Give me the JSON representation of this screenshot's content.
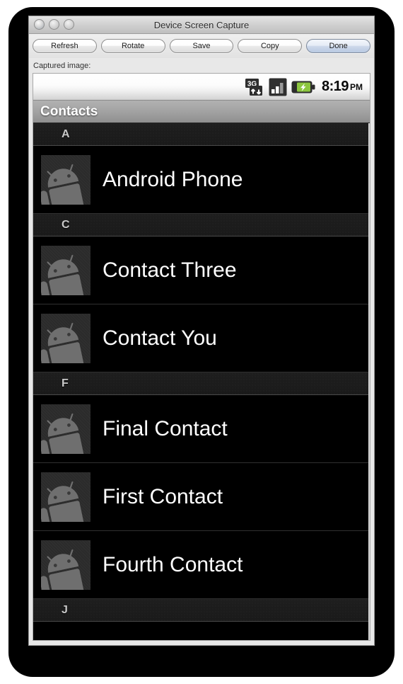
{
  "window": {
    "title": "Device Screen Capture",
    "traffic_lights": [
      "close",
      "minimize",
      "zoom"
    ]
  },
  "toolbar": {
    "buttons": [
      {
        "label": "Refresh",
        "name": "refresh-button",
        "default": false
      },
      {
        "label": "Rotate",
        "name": "rotate-button",
        "default": false
      },
      {
        "label": "Save",
        "name": "save-button",
        "default": false
      },
      {
        "label": "Copy",
        "name": "copy-button",
        "default": false
      },
      {
        "label": "Done",
        "name": "done-button",
        "default": true
      }
    ]
  },
  "captured": {
    "label": "Captured image:"
  },
  "device": {
    "statusbar": {
      "icons": [
        "3g-data-icon",
        "signal-bars-icon",
        "battery-charging-icon"
      ],
      "time": "8:19",
      "ampm": "PM"
    },
    "app": {
      "title": "Contacts"
    },
    "list": [
      {
        "type": "section",
        "letter": "A"
      },
      {
        "type": "contact",
        "name": "Android Phone",
        "avatar": "android-robot-avatar"
      },
      {
        "type": "section",
        "letter": "C"
      },
      {
        "type": "contact",
        "name": "Contact Three",
        "avatar": "android-robot-avatar"
      },
      {
        "type": "contact",
        "name": "Contact You",
        "avatar": "android-robot-avatar"
      },
      {
        "type": "section",
        "letter": "F"
      },
      {
        "type": "contact",
        "name": "Final Contact",
        "avatar": "android-robot-avatar"
      },
      {
        "type": "contact",
        "name": "First Contact",
        "avatar": "android-robot-avatar"
      },
      {
        "type": "contact",
        "name": "Fourth Contact",
        "avatar": "android-robot-avatar"
      },
      {
        "type": "section",
        "letter": "J"
      }
    ]
  },
  "colors": {
    "list_background": "#000000",
    "section_background": "#1c1c1c",
    "avatar_robot": "#6f6f6f",
    "contacts_bar": "#a4a4a4",
    "default_button": "#c6d4e8"
  }
}
